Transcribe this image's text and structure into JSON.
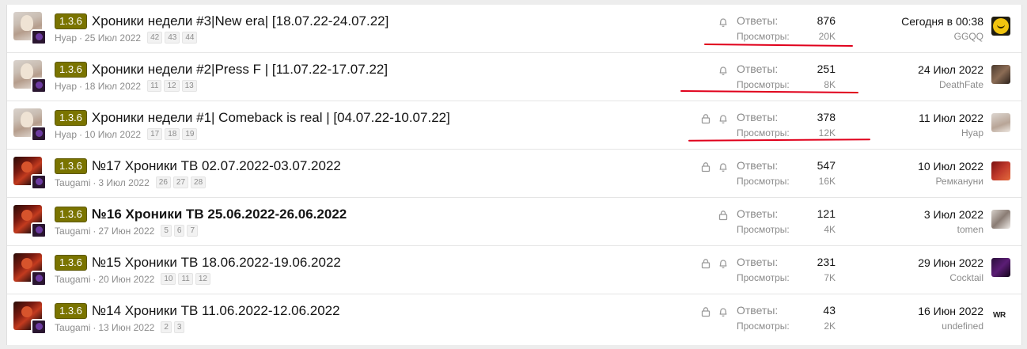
{
  "threads": [
    {
      "prefix": "1.3.6",
      "title": "Хроники недели #3|New era| [18.07.22-24.07.22]",
      "bold": false,
      "author": "Hyap",
      "date": "25 Июл 2022",
      "pages": [
        "42",
        "43",
        "44"
      ],
      "locked": false,
      "watched": true,
      "replies_label": "Ответы:",
      "replies": "876",
      "views_label": "Просмотры:",
      "views": "20K",
      "last_date": "Сегодня в 00:38",
      "last_user": "GGQQ",
      "avatar_style": "blonde",
      "last_avatar": "ggqq-avatar"
    },
    {
      "prefix": "1.3.6",
      "title": "Хроники недели #2|Press F | [11.07.22-17.07.22]",
      "bold": false,
      "author": "Hyap",
      "date": "18 Июл 2022",
      "pages": [
        "11",
        "12",
        "13"
      ],
      "locked": false,
      "watched": true,
      "replies_label": "Ответы:",
      "replies": "251",
      "views_label": "Просмотры:",
      "views": "8K",
      "last_date": "24 Июл 2022",
      "last_user": "DeathFate",
      "avatar_style": "blonde",
      "last_avatar": "deathfate-avatar"
    },
    {
      "prefix": "1.3.6",
      "title": "Хроники недели #1| Comeback is real | [04.07.22-10.07.22]",
      "bold": false,
      "author": "Hyap",
      "date": "10 Июл 2022",
      "pages": [
        "17",
        "18",
        "19"
      ],
      "locked": true,
      "watched": true,
      "replies_label": "Ответы:",
      "replies": "378",
      "views_label": "Просмотры:",
      "views": "12K",
      "last_date": "11 Июл 2022",
      "last_user": "Hyap",
      "avatar_style": "blonde",
      "last_avatar": "hyap-avatar"
    },
    {
      "prefix": "1.3.6",
      "title": "№17 Хроники ТВ 02.07.2022-03.07.2022",
      "bold": false,
      "author": "Taugami",
      "date": "3 Июл 2022",
      "pages": [
        "26",
        "27",
        "28"
      ],
      "locked": true,
      "watched": true,
      "replies_label": "Ответы:",
      "replies": "547",
      "views_label": "Просмотры:",
      "views": "16K",
      "last_date": "10 Июл 2022",
      "last_user": "Ремкануни",
      "avatar_style": "red",
      "last_avatar": "remkanuni-avatar"
    },
    {
      "prefix": "1.3.6",
      "title": "№16 Хроники ТВ 25.06.2022-26.06.2022",
      "bold": true,
      "author": "Taugami",
      "date": "27 Июн 2022",
      "pages": [
        "5",
        "6",
        "7"
      ],
      "locked": true,
      "watched": false,
      "replies_label": "Ответы:",
      "replies": "121",
      "views_label": "Просмотры:",
      "views": "4K",
      "last_date": "3 Июл 2022",
      "last_user": "tomen",
      "avatar_style": "red",
      "last_avatar": "tomen-avatar"
    },
    {
      "prefix": "1.3.6",
      "title": "№15 Хроники ТВ 18.06.2022-19.06.2022",
      "bold": false,
      "author": "Taugami",
      "date": "20 Июн 2022",
      "pages": [
        "10",
        "11",
        "12"
      ],
      "locked": true,
      "watched": true,
      "replies_label": "Ответы:",
      "replies": "231",
      "views_label": "Просмотры:",
      "views": "7K",
      "last_date": "29 Июн 2022",
      "last_user": "Cocktail",
      "avatar_style": "red",
      "last_avatar": "cocktail-avatar"
    },
    {
      "prefix": "1.3.6",
      "title": "№14 Хроники ТВ 11.06.2022-12.06.2022",
      "bold": false,
      "author": "Taugami",
      "date": "13 Июн 2022",
      "pages": [
        "2",
        "3"
      ],
      "locked": true,
      "watched": true,
      "replies_label": "Ответы:",
      "replies": "43",
      "views_label": "Просмотры:",
      "views": "2K",
      "last_date": "16 Июн 2022",
      "last_user": "undefined",
      "avatar_style": "red",
      "last_avatar": "undefined-avatar",
      "last_avatar_text": "WR"
    }
  ],
  "colors": {
    "prefix_badge": "#7a7400",
    "annotation_red": "#e0001b"
  }
}
